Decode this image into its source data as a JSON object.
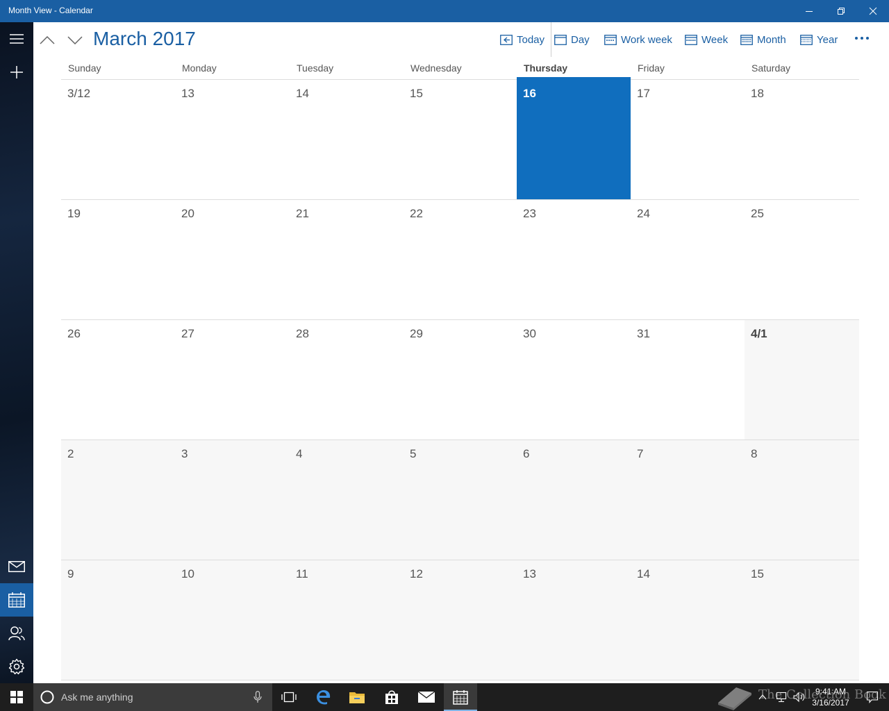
{
  "window": {
    "title": "Month View - Calendar"
  },
  "header": {
    "month_title": "March 2017",
    "toolbar": [
      {
        "label": "Today",
        "icon": "today-icon"
      },
      {
        "label": "Day",
        "icon": "day-icon"
      },
      {
        "label": "Work week",
        "icon": "work-week-icon"
      },
      {
        "label": "Week",
        "icon": "week-icon"
      },
      {
        "label": "Month",
        "icon": "month-icon"
      },
      {
        "label": "Year",
        "icon": "year-icon"
      }
    ]
  },
  "calendar": {
    "weekdays": [
      "Sunday",
      "Monday",
      "Tuesday",
      "Wednesday",
      "Thursday",
      "Friday",
      "Saturday"
    ],
    "current_weekday_index": 4,
    "weeks": [
      [
        {
          "label": "3/12",
          "type": "current"
        },
        {
          "label": "13",
          "type": "current"
        },
        {
          "label": "14",
          "type": "current"
        },
        {
          "label": "15",
          "type": "current"
        },
        {
          "label": "16",
          "type": "today"
        },
        {
          "label": "17",
          "type": "current"
        },
        {
          "label": "18",
          "type": "current"
        }
      ],
      [
        {
          "label": "19",
          "type": "current"
        },
        {
          "label": "20",
          "type": "current"
        },
        {
          "label": "21",
          "type": "current"
        },
        {
          "label": "22",
          "type": "current"
        },
        {
          "label": "23",
          "type": "current"
        },
        {
          "label": "24",
          "type": "current"
        },
        {
          "label": "25",
          "type": "current"
        }
      ],
      [
        {
          "label": "26",
          "type": "current"
        },
        {
          "label": "27",
          "type": "current"
        },
        {
          "label": "28",
          "type": "current"
        },
        {
          "label": "29",
          "type": "current"
        },
        {
          "label": "30",
          "type": "current"
        },
        {
          "label": "31",
          "type": "current"
        },
        {
          "label": "4/1",
          "type": "month-start"
        }
      ],
      [
        {
          "label": "2",
          "type": "other"
        },
        {
          "label": "3",
          "type": "other"
        },
        {
          "label": "4",
          "type": "other"
        },
        {
          "label": "5",
          "type": "other"
        },
        {
          "label": "6",
          "type": "other"
        },
        {
          "label": "7",
          "type": "other"
        },
        {
          "label": "8",
          "type": "other"
        }
      ],
      [
        {
          "label": "9",
          "type": "other"
        },
        {
          "label": "10",
          "type": "other"
        },
        {
          "label": "11",
          "type": "other"
        },
        {
          "label": "12",
          "type": "other"
        },
        {
          "label": "13",
          "type": "other"
        },
        {
          "label": "14",
          "type": "other"
        },
        {
          "label": "15",
          "type": "other"
        }
      ]
    ]
  },
  "taskbar": {
    "search_placeholder": "Ask me anything",
    "time": "9:41 AM",
    "date": "3/16/2017",
    "watermark": "The Collection Book"
  },
  "colors": {
    "accent": "#1a5fa3",
    "today_fill": "#106ebe",
    "other_month_bg": "#f7f7f7"
  }
}
